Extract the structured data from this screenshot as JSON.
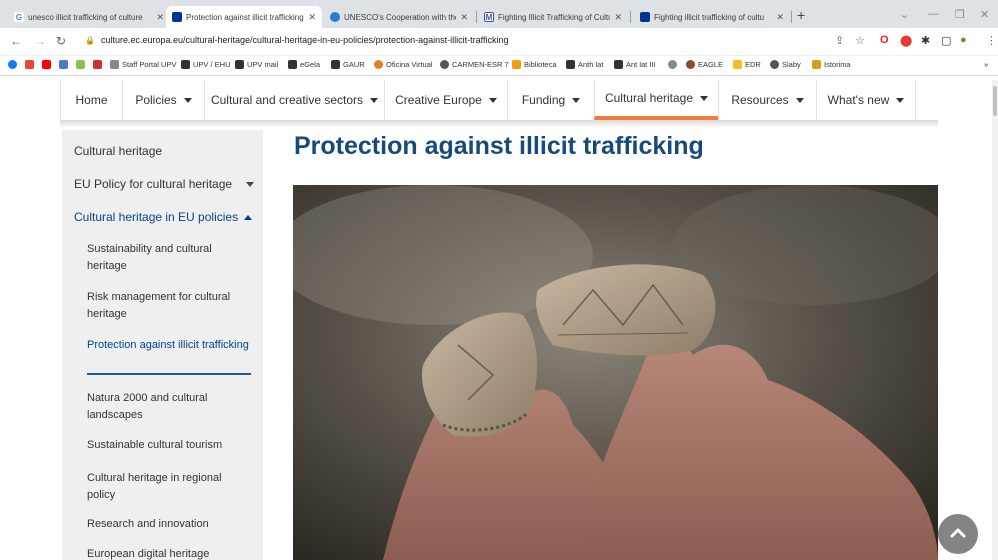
{
  "browser": {
    "tabs": [
      {
        "title": "unesco illicit trafficking of culture",
        "favicon": "google-g-icon",
        "color": "#4285f4"
      },
      {
        "title": "Protection against illicit trafficking",
        "favicon": "eu-flag-icon",
        "color": "#003399"
      },
      {
        "title": "UNESCO's Cooperation with the",
        "favicon": "globe-icon",
        "color": "#2a7bd6"
      },
      {
        "title": "Fighting Illicit Trafficking of Cultu",
        "favicon": "m-logo-icon",
        "color": "#3b5998"
      },
      {
        "title": "Fighting illicit trafficking of cultu",
        "favicon": "eu-flag-icon",
        "color": "#003399"
      }
    ],
    "url": "culture.ec.europa.eu/cultural-heritage/cultural-heritage-in-eu-policies/protection-against-illicit-trafficking",
    "bookmarks": [
      {
        "label": "",
        "color": "#1877f2"
      },
      {
        "label": "",
        "color": "#ea4335"
      },
      {
        "label": "",
        "color": "#ff0000"
      },
      {
        "label": "",
        "color": "#4a7bd0"
      },
      {
        "label": "",
        "color": "#8bc34a"
      },
      {
        "label": "",
        "color": "#d32f2f"
      },
      {
        "label": "Staff Portal UPV",
        "color": "#888888"
      },
      {
        "label": "UPV / EHU",
        "color": "#333333"
      },
      {
        "label": "UPV mail",
        "color": "#333333"
      },
      {
        "label": "eGela",
        "color": "#333333"
      },
      {
        "label": "GAUR",
        "color": "#333333"
      },
      {
        "label": "Oficina Virtual",
        "color": "#e67e22"
      },
      {
        "label": "CARMEN-ESR 7",
        "color": "#555555"
      },
      {
        "label": "Biblioteca",
        "color": "#f39c12"
      },
      {
        "label": "Anth lat",
        "color": "#333333"
      },
      {
        "label": "Ant lat III",
        "color": "#333333"
      },
      {
        "label": "",
        "color": "#888888"
      },
      {
        "label": "EAGLE",
        "color": "#8d4a2b"
      },
      {
        "label": "EDR",
        "color": "#f0c020"
      },
      {
        "label": "Slaby",
        "color": "#555555"
      },
      {
        "label": "Istorima",
        "color": "#d4a017"
      }
    ]
  },
  "site_nav": {
    "items": [
      {
        "label": "Home",
        "caret": false
      },
      {
        "label": "Policies",
        "caret": true
      },
      {
        "label": "Cultural and creative sectors",
        "caret": true
      },
      {
        "label": "Creative Europe",
        "caret": true
      },
      {
        "label": "Funding",
        "caret": true
      },
      {
        "label": "Cultural heritage",
        "caret": true,
        "active": true
      },
      {
        "label": "Resources",
        "caret": true
      },
      {
        "label": "What's new",
        "caret": true
      }
    ],
    "active_color": "#f07b3f"
  },
  "sidebar": {
    "top": "Cultural heritage",
    "eu_policy": "EU Policy for cultural heritage",
    "section": "Cultural heritage in EU policies",
    "sub_items": [
      "Sustainability and cultural heritage",
      "Risk management for cultural heritage",
      "Protection against illicit trafficking",
      "Natura 2000 and cultural landscapes",
      "Sustainable cultural tourism",
      "Cultural heritage in regional policy",
      "Research and innovation",
      "European digital heritage"
    ],
    "active_sub": 2
  },
  "main": {
    "title": "Protection against illicit trafficking",
    "title_color": "#174a7c",
    "hero_image": "hands-holding-pottery-shards-photo"
  }
}
